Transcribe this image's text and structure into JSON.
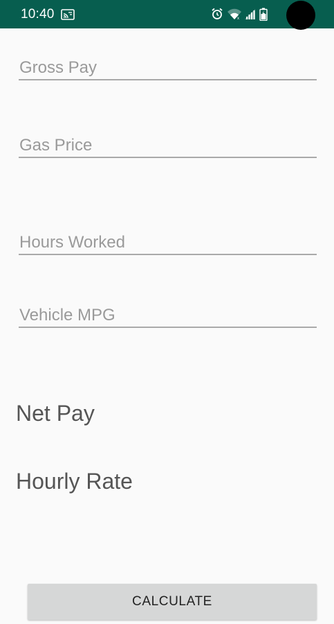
{
  "status_bar": {
    "time": "10:40",
    "icons": [
      "cast-icon",
      "alarm-icon",
      "wifi-icon",
      "signal-icon",
      "battery-icon"
    ],
    "background_color": "#075e4f"
  },
  "form": {
    "gross_pay": {
      "value": "",
      "placeholder": "Gross Pay"
    },
    "gas_price": {
      "value": "",
      "placeholder": "Gas Price"
    },
    "hours_worked": {
      "value": "",
      "placeholder": "Hours Worked"
    },
    "vehicle_mpg": {
      "value": "",
      "placeholder": "Vehicle MPG"
    }
  },
  "results": {
    "net_pay_label": "Net Pay",
    "hourly_rate_label": "Hourly Rate"
  },
  "actions": {
    "calculate_label": "CALCULATE"
  }
}
